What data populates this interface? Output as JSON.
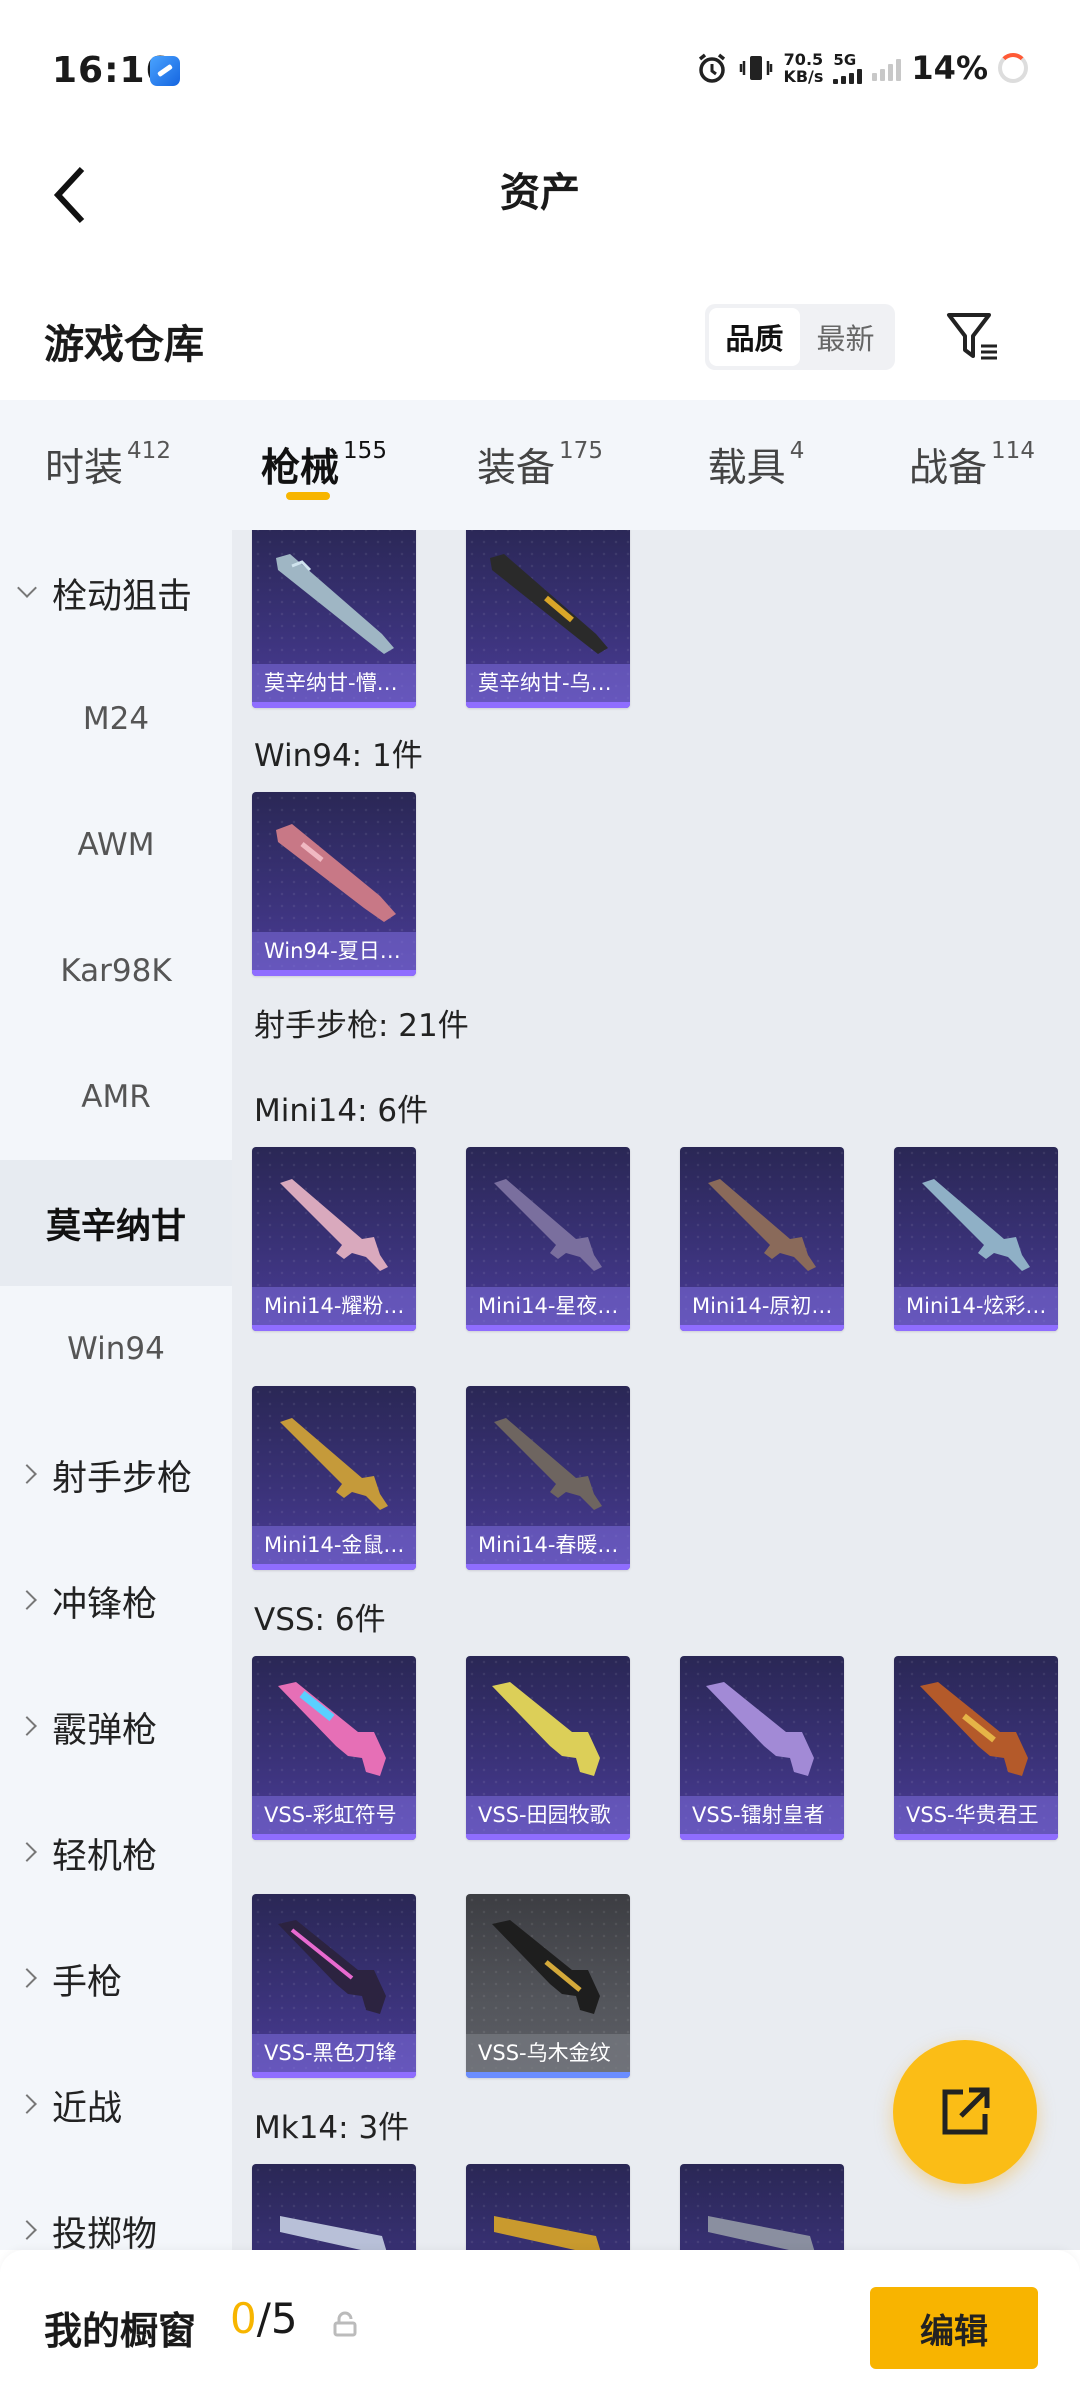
{
  "status_bar": {
    "time": "16:16",
    "speed_value": "70.5",
    "speed_unit": "KB/s",
    "network": "5G",
    "battery": "14%"
  },
  "header": {
    "title": "资产"
  },
  "section": {
    "title": "游戏仓库",
    "sort_quality": "品质",
    "sort_newest": "最新"
  },
  "tabs": [
    {
      "label": "时装",
      "count": "412"
    },
    {
      "label": "枪械",
      "count": "155"
    },
    {
      "label": "装备",
      "count": "175"
    },
    {
      "label": "载具",
      "count": "4"
    },
    {
      "label": "战备",
      "count": "114"
    }
  ],
  "sidebar": [
    {
      "label": "栓动狙击",
      "type": "category",
      "open": true
    },
    {
      "label": "M24",
      "type": "sub"
    },
    {
      "label": "AWM",
      "type": "sub"
    },
    {
      "label": "Kar98K",
      "type": "sub"
    },
    {
      "label": "AMR",
      "type": "sub"
    },
    {
      "label": "莫辛纳甘",
      "type": "sub",
      "selected": true
    },
    {
      "label": "Win94",
      "type": "sub"
    },
    {
      "label": "射手步枪",
      "type": "category"
    },
    {
      "label": "冲锋枪",
      "type": "category"
    },
    {
      "label": "霰弹枪",
      "type": "category"
    },
    {
      "label": "轻机枪",
      "type": "category"
    },
    {
      "label": "手枪",
      "type": "category"
    },
    {
      "label": "近战",
      "type": "category"
    },
    {
      "label": "投掷物",
      "type": "category"
    }
  ],
  "content": {
    "labels": {
      "win94": "Win94: 1件",
      "marksman": "射手步枪: 21件",
      "mini14": "Mini14: 6件",
      "vss": "VSS: 6件",
      "mk14": "Mk14: 3件"
    },
    "mosin_items": [
      "莫辛纳甘-懵…",
      "莫辛纳甘-乌…"
    ],
    "win94_items": [
      "Win94-夏日…"
    ],
    "mini14_items": [
      "Mini14-耀粉…",
      "Mini14-星夜…",
      "Mini14-原初…",
      "Mini14-炫彩…",
      "Mini14-金鼠…",
      "Mini14-春暖…"
    ],
    "vss_items": [
      "VSS-彩虹符号",
      "VSS-田园牧歌",
      "VSS-镭射皇者",
      "VSS-华贵君王",
      "VSS-黑色刀锋",
      "VSS-乌木金纹"
    ]
  },
  "bottom": {
    "label": "我的橱窗",
    "count_current": "0",
    "count_total": "/5",
    "edit_button": "编辑"
  },
  "colors": {
    "accent": "#f7b500",
    "card_bg": "#3a3278",
    "card_caption": "#7e6edc"
  }
}
